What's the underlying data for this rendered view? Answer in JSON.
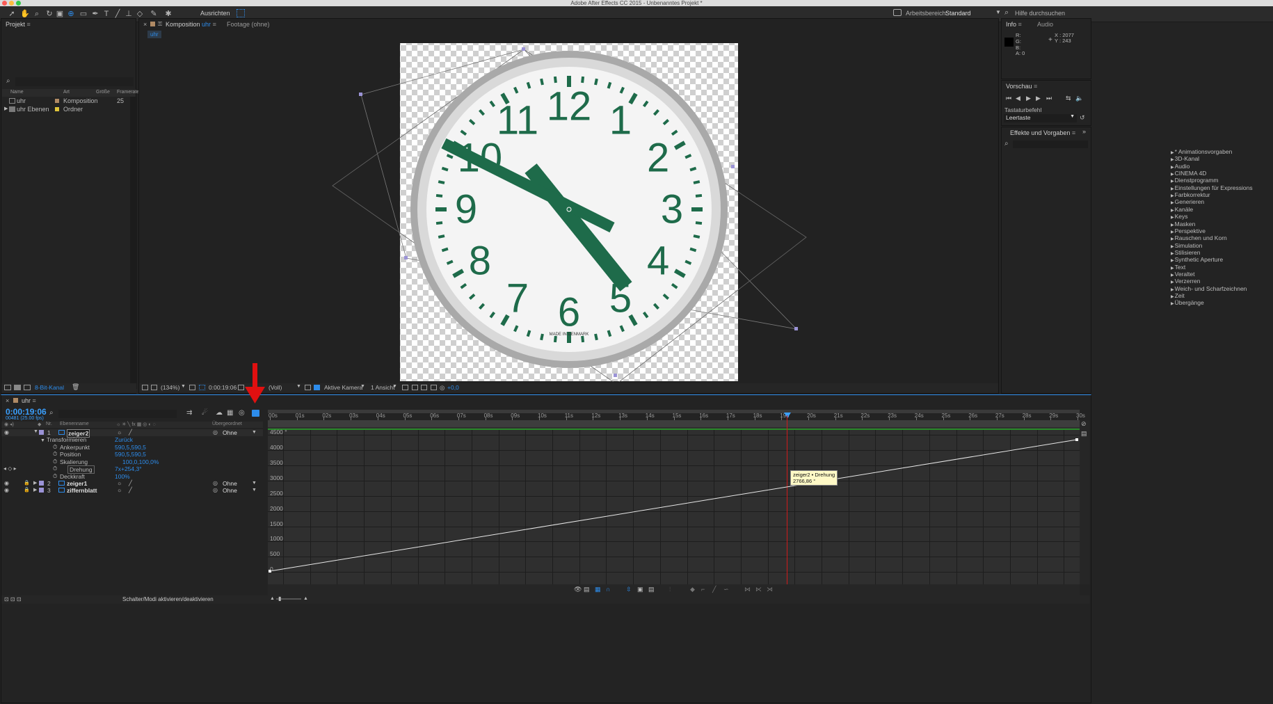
{
  "window": {
    "title": "Adobe After Effects CC 2015 - Unbenanntes Projekt *"
  },
  "toolbar": {
    "align_label": "Ausrichten",
    "workspace_label": "Arbeitsbereich:",
    "workspace_value": "Standard",
    "search_help": "Hilfe durchsuchen"
  },
  "project": {
    "tab": "Projekt",
    "columns": [
      "Name",
      "Art",
      "Größe",
      "Framerate"
    ],
    "items": [
      {
        "name": "uhr",
        "type": "Komposition",
        "framerate": "25",
        "color": "#b08a64"
      },
      {
        "name": "uhr Ebenen",
        "type": "Ordner",
        "framerate": "",
        "color": "#e0c53a"
      }
    ],
    "bit_depth": "8-Bit-Kanal"
  },
  "comp": {
    "tab_prefix": "Komposition",
    "tab_name": "uhr",
    "footage_tab": "Footage (ohne)",
    "breadcrumb": "uhr",
    "zoom": "(134%)",
    "time": "0:00:19:06",
    "resolution": "(Voll)",
    "camera": "Aktive Kamera",
    "views": "1 Ansicht",
    "exposure": "+0,0"
  },
  "info": {
    "tab": "Info",
    "audio_tab": "Audio",
    "r": "R:",
    "g": "G:",
    "b": "B:",
    "a": "A:  0",
    "x": "X : 2077",
    "y": "Y : 243"
  },
  "preview": {
    "tab": "Vorschau",
    "shortcut_label": "Tastaturbefehl",
    "shortcut_value": "Leertaste"
  },
  "effects": {
    "tab": "Effekte und Vorgaben",
    "items": [
      "* Animationsvorgaben",
      "3D-Kanal",
      "Audio",
      "CINEMA 4D",
      "Dienstprogramm",
      "Einstellungen für Expressions",
      "Farbkorrektur",
      "Generieren",
      "Kanäle",
      "Keys",
      "Masken",
      "Perspektive",
      "Rauschen und Korn",
      "Simulation",
      "Stilisieren",
      "Synthetic Aperture",
      "Text",
      "Veraltet",
      "Verzerren",
      "Weich- und Scharfzeichnen",
      "Zeit",
      "Übergänge"
    ]
  },
  "timeline": {
    "tab": "uhr",
    "timecode": "0:00:19:06",
    "frames": "00481 (25.00 fps)",
    "col_nr": "Nr.",
    "col_name": "Ebenenname",
    "col_parent": "Übergeordnet",
    "layers": [
      {
        "nr": "1",
        "name": "zeiger2",
        "parent": "Ohne"
      },
      {
        "nr": "2",
        "name": "zeiger1",
        "parent": "Ohne"
      },
      {
        "nr": "3",
        "name": "ziffernblatt",
        "parent": "Ohne"
      }
    ],
    "transform_label": "Transformieren",
    "reset_label": "Zurück",
    "props": [
      {
        "name": "Ankerpunkt",
        "value": "590,5,590,5"
      },
      {
        "name": "Position",
        "value": "590,5,590,5"
      },
      {
        "name": "Skalierung",
        "value": "100,0,100,0%"
      },
      {
        "name": "Drehung",
        "value": "7x+254,3°"
      },
      {
        "name": "Deckkraft",
        "value": "100%"
      }
    ],
    "ticks": [
      "00s",
      "01s",
      "02s",
      "03s",
      "04s",
      "05s",
      "06s",
      "07s",
      "08s",
      "09s",
      "10s",
      "11s",
      "12s",
      "13s",
      "14s",
      "15s",
      "16s",
      "17s",
      "18s",
      "19s",
      "20s",
      "21s",
      "22s",
      "23s",
      "24s",
      "25s",
      "26s",
      "27s",
      "28s",
      "29s",
      "30s"
    ],
    "graph_ylabels": [
      "4500 °",
      "4000",
      "3500",
      "3000",
      "2500",
      "2000",
      "1500",
      "1000",
      "500",
      "0"
    ],
    "tooltip_line1": "zeiger2 • Drehung",
    "tooltip_line2": "2766,86 °",
    "footer": "Schalter/Modi aktivieren/deaktivieren"
  },
  "clock": {
    "numerals": [
      "12",
      "1",
      "2",
      "3",
      "4",
      "5",
      "6",
      "7",
      "8",
      "9",
      "10",
      "11"
    ],
    "brand": "MADE IN DENMARK"
  },
  "colors": {
    "accent": "#2d8ceb",
    "clock_green": "#1e6b4a",
    "annotation": "#e01010"
  }
}
